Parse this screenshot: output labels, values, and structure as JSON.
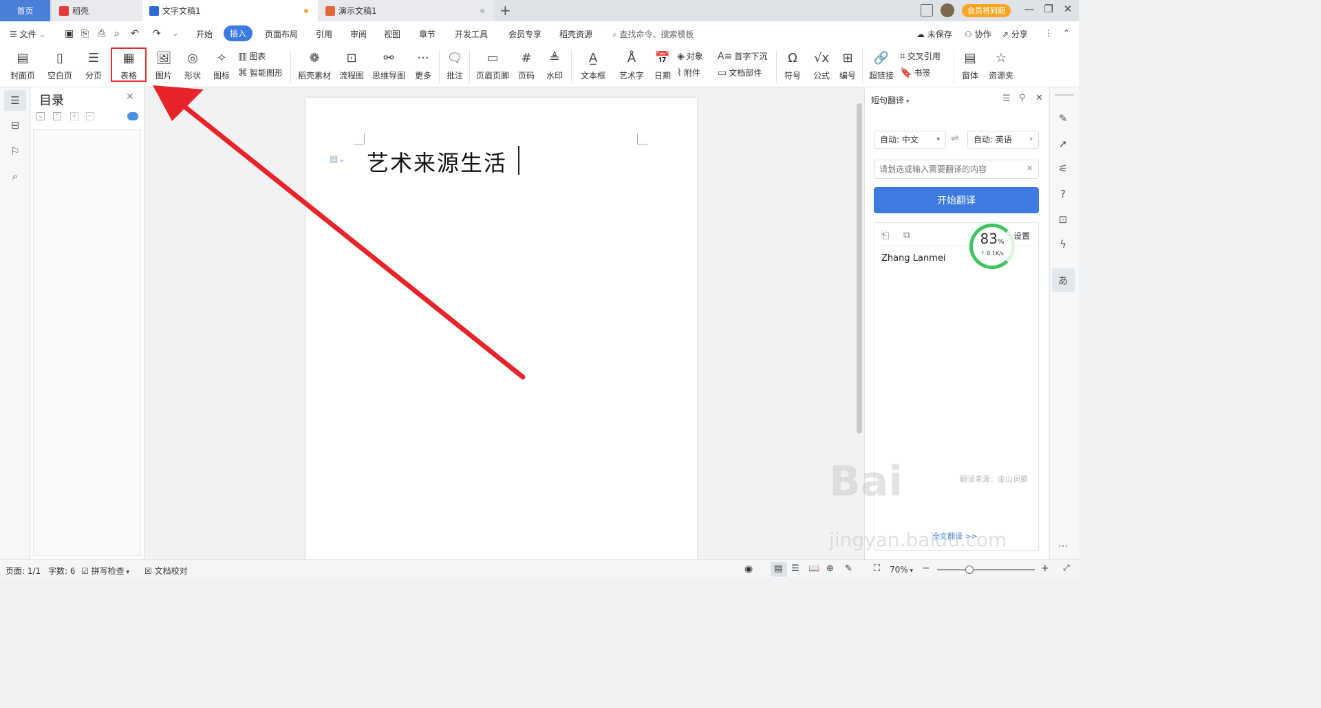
{
  "tabs": [
    {
      "label": "首页",
      "color": "#4a7fd8"
    },
    {
      "label": "稻壳",
      "color": "#e23c3c"
    },
    {
      "label": "文字文稿1",
      "color": "#2f6bd8"
    },
    {
      "label": "演示文稿1",
      "color": "#e2663c"
    }
  ],
  "header": {
    "vip_label": "会员将到期"
  },
  "menu": {
    "file": "文件",
    "items": [
      "开始",
      "插入",
      "页面布局",
      "引用",
      "审阅",
      "视图",
      "章节",
      "开发工具",
      "会员专享",
      "稻壳资源"
    ],
    "search_placeholder": "查找命令、搜索模板",
    "unsaved": "未保存",
    "collab": "协作",
    "share": "分享"
  },
  "ribbon": {
    "cover": "封面页",
    "blank": "空白页",
    "pagebreak": "分页",
    "table": "表格",
    "picture": "图片",
    "shape": "形状",
    "icons": "图标",
    "chart": "图表",
    "smartart": "智能图形",
    "daoke": "稻壳素材",
    "flow": "流程图",
    "mindmap": "思维导图",
    "more": "更多",
    "comment": "批注",
    "headerfooter": "页眉页脚",
    "pagenum": "页码",
    "watermark": "水印",
    "textbox": "文本框",
    "wordart": "艺术字",
    "date": "日期",
    "object": "对象",
    "attachment": "附件",
    "dropcap": "首字下沉",
    "docparts": "文档部件",
    "symbol": "符号",
    "formula": "公式",
    "numbering": "编号",
    "hyperlink": "超链接",
    "crossref": "交叉引用",
    "bookmark": "书签",
    "window": "窗体",
    "resources": "资源夹"
  },
  "toc": {
    "title": "目录"
  },
  "document": {
    "text": "艺术来源生活"
  },
  "translate": {
    "title": "短句翻译",
    "source_lang": "自动: 中文",
    "target_lang": "自动: 英语",
    "input_placeholder": "请划选或输入需要翻译的内容",
    "button": "开始翻译",
    "settings": "设置",
    "result": "Zhang Lanmei",
    "source": "翻译来源：金山词霸",
    "note": "全文翻译 >>",
    "speed_percent": "83",
    "speed_rate": "0.1K/s"
  },
  "status": {
    "page": "页面: 1/1",
    "wordcount": "字数: 6",
    "spellcheck": "拼写检查",
    "proof": "文档校对",
    "zoom": "70%"
  },
  "watermark": {
    "text1": "Bai",
    "text2": "jingyan.baidu.com"
  },
  "colors": {
    "accent": "#3d7be0",
    "arrow": "#e8242a",
    "highlight": "#e53030"
  }
}
